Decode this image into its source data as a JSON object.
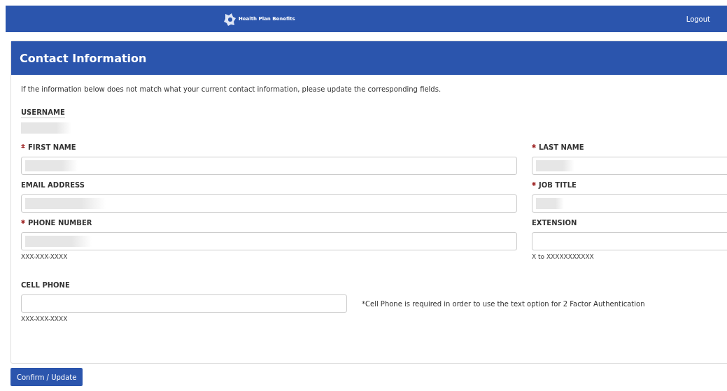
{
  "header": {
    "brand": "Health Plan Benefits",
    "logout": "Logout"
  },
  "card": {
    "title": "Contact Information",
    "intro": "If the information below does not match what your current contact information, please update the corresponding fields.",
    "username": {
      "label": "USERNAME",
      "redacted": true
    },
    "fields": [
      {
        "label": "FIRST NAME",
        "required": true,
        "redacted": true
      },
      {
        "label": "LAST NAME",
        "required": true,
        "redacted": true
      },
      {
        "label": "EMAIL ADDRESS",
        "required": false,
        "redacted": true
      },
      {
        "label": "JOB TITLE",
        "required": true,
        "redacted": true
      },
      {
        "label": "PHONE NUMBER",
        "required": true,
        "redacted": true,
        "hint": "XXX-XXX-XXXX"
      },
      {
        "label": "EXTENSION",
        "required": false,
        "redacted": false,
        "hint": "X to XXXXXXXXXXX"
      }
    ],
    "cell_phone": {
      "label": "CELL PHONE",
      "redacted": false,
      "hint": "XXX-XXX-XXXX",
      "note": "*Cell Phone is required in order to use the text option for 2 Factor Authentication"
    }
  },
  "button": "Confirm / Update"
}
